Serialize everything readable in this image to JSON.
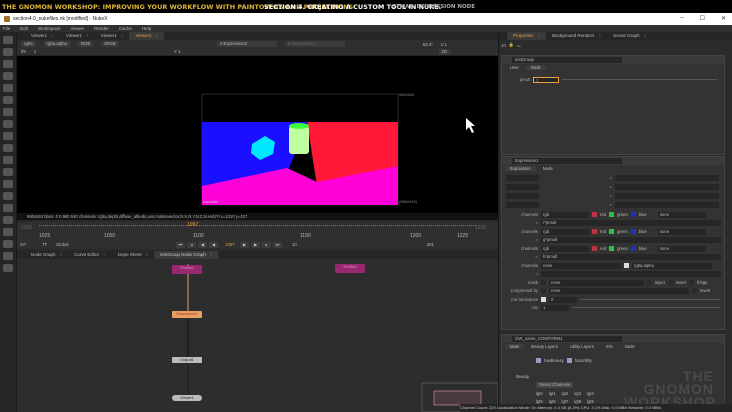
{
  "banner": {
    "course": "THE GNOMON WORKSHOP: IMPROVING YOUR WORKFLOW WITH PAINTOVERS AND PROJECTIONS",
    "section": "SECTION 4.  CREATING A CUSTOM TOOL IN NUKE.",
    "topic": "STMAP. EXPRESSION NODE"
  },
  "window": {
    "title": "section4.0_nukefiles.nk [modified] - NukeX",
    "min": "–",
    "max": "☐",
    "close": "✕"
  },
  "menu": [
    "File",
    "Edit",
    "Workspace",
    "Viewer",
    "Render",
    "Cache",
    "Help"
  ],
  "viewer": {
    "tabs": [
      "Viewer1",
      "Viewer1",
      "Viewer1",
      "Viewer1"
    ],
    "channels": "rgba",
    "alpha": "rgba.alpha",
    "display": "RGB",
    "colorspace": "sRGB",
    "input_a": "A  Expression2",
    "input_b": "B  Expression1",
    "zoom": "53.3*",
    "ratio": "1:1",
    "fstop_label": "f/8",
    "y_label": "Y 1",
    "gain": "1",
    "mode": "2D",
    "format_label": "960x540",
    "format_label_bottom": "(960x540)",
    "image_label": "translate",
    "info": "960x540  bbox: 0 0 960 540 channels: rgba,depth,diffuse_albedo,uvs,motionvector,N.X,N.Y,N.Z,N.red,P.l  x=1310 y=427"
  },
  "timeline": {
    "start": "1025",
    "end": "1225",
    "ticks": [
      "1025",
      "1050",
      "1100",
      "1150",
      "1200",
      "1225"
    ],
    "current": "1097",
    "fps": "24*",
    "tf": "TF",
    "global": "Global",
    "step": "10",
    "end_frame": "201"
  },
  "nodegraph": {
    "tabs": [
      "Node Graph",
      "Curve Editor",
      "Dope Sheet",
      "testGroup Node Graph"
    ],
    "nodes": {
      "shuffle1": "Shuffle1",
      "shuffle2": "Shuffle2",
      "expression": "Expression1",
      "output": "Output1",
      "viewer": "Viewer1"
    }
  },
  "right": {
    "tabs": [
      "Properties",
      "Background Renders",
      "Scene Graph"
    ],
    "max_panels": "10",
    "testgroup": {
      "name": "testGroup",
      "tabs": [
        "User",
        "Node"
      ],
      "pmult_label": "pmult",
      "pmult_value": "1"
    },
    "expression": {
      "name": "Expression1",
      "tabs": [
        "Expression",
        "Node"
      ],
      "rows": [
        {
          "label": "channels",
          "value": "rgb",
          "c1": "red",
          "c2": "green",
          "c3": "blue",
          "extra": "none",
          "expr": "r*pmult"
        },
        {
          "label": "channels",
          "value": "rgb",
          "c1": "red",
          "c2": "green",
          "c3": "blue",
          "extra": "none",
          "expr": "g*pmult"
        },
        {
          "label": "channels",
          "value": "rgb",
          "c1": "red",
          "c2": "green",
          "c3": "blue",
          "extra": "none",
          "expr": "b*pmult"
        },
        {
          "label": "channels",
          "value": "none",
          "c1": "",
          "c2": "",
          "c3": "",
          "extra": "rgba.alpha",
          "expr": ""
        }
      ],
      "eq": "=",
      "mask_label": "mask",
      "mask_value": "none",
      "inject": "inject",
      "invert": "invert",
      "fringe": "fringe",
      "premult_label": "(un)premult by",
      "premult_value": "none",
      "invert2": "invert",
      "mixlum_label": "mix luminance",
      "mixlum_value": "0",
      "mix_label": "mix",
      "mix_value": "1"
    },
    "gw": {
      "name": "GW_name_CONFORM1",
      "tabs": [
        "Main",
        "Beauty Layers",
        "Utility Layers",
        "Info",
        "Node"
      ],
      "hasBeauty": "hasBeauty",
      "hasUtility": "hasUtility",
      "beauty_label": "Beauty",
      "detect": "Detect Channels",
      "lights": [
        "lgt0",
        "lgt1",
        "lgt2",
        "lgt3",
        "lgt4",
        "lgt5",
        "lgt6",
        "lgt7",
        "lgt8",
        "lgt9"
      ]
    }
  },
  "status": "Channel Count: 229  Localization Mode: On  Memory: 4.0 GB (6.3%)  CPU: 3.1%  Disk: 0.0 MB/s  Network: 0.0 MB/s",
  "watermark": "THE GNOMON WORKSHOP",
  "colors": {
    "accent": "#e8a040",
    "banner_yellow": "#e0b838",
    "node_shuffle": "#9a2870",
    "node_expr": "#e8a060"
  }
}
